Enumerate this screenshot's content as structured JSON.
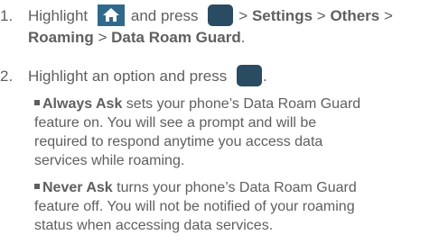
{
  "step1": {
    "number": "1.",
    "text_highlight": "Highlight",
    "text_and_press": "and press",
    "sep1": ">",
    "settings": "Settings",
    "sep2": ">",
    "others": "Others",
    "sep3": ">",
    "roaming": "Roaming",
    "sep4": ">",
    "data_roam_guard": "Data Roam Guard",
    "end_period": "."
  },
  "step2": {
    "number": "2.",
    "text": "Highlight an option and press",
    "end_period": "."
  },
  "bullets": [
    {
      "term": "Always Ask",
      "line1_rest": " sets your phone’s Data Roam Guard",
      "line2": "feature on. You will see a prompt and will be",
      "line3": "required to respond anytime you access data",
      "line4": "services while roaming."
    },
    {
      "term": "Never Ask",
      "line1_rest": " turns your phone’s Data Roam Guard",
      "line2": "feature off. You will not be notified of your roaming",
      "line3": "status when accessing data services."
    }
  ],
  "icons": {
    "home": "home-icon",
    "ok": "menu-ok-key-icon"
  },
  "colors": {
    "text": "#5f5f5f",
    "home_key_bg": "#2f6a8c",
    "ok_key_bg": "#2a4c63"
  }
}
